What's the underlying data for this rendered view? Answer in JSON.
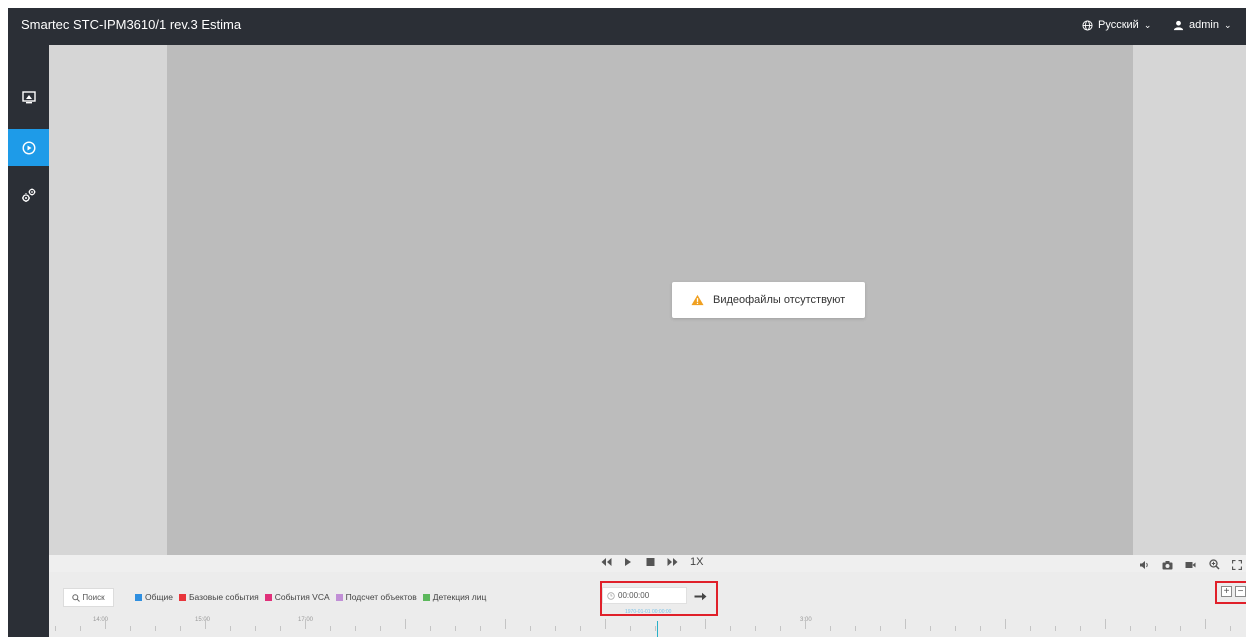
{
  "header": {
    "title": "Smartec STC-IPM3610/1 rev.3 Estima",
    "language": "Русский",
    "user": "admin"
  },
  "sidebar": {
    "items": [
      {
        "name": "live-view",
        "icon": "monitor-icon",
        "active": false
      },
      {
        "name": "playback",
        "icon": "play-circle-icon",
        "active": true
      },
      {
        "name": "settings",
        "icon": "gears-icon",
        "active": false
      }
    ]
  },
  "player": {
    "message": "Видеофайлы отсутствуют",
    "speed": "1X"
  },
  "search": {
    "label": "Поиск"
  },
  "legend": [
    {
      "label": "Общие",
      "color": "#2f8fe0"
    },
    {
      "label": "Базовые события",
      "color": "#e8353b"
    },
    {
      "label": "События VCA",
      "color": "#e0307a"
    },
    {
      "label": "Подсчет объектов",
      "color": "#c18fd6"
    },
    {
      "label": "Детекция лиц",
      "color": "#5cb85c"
    }
  ],
  "time_input": {
    "value": "00:00:00"
  },
  "timeline": {
    "labels": [
      "14:00",
      "15:00",
      "17:00",
      "3:00"
    ],
    "cursor_label": "1970-01-01 00:00:00"
  },
  "colors": {
    "accent": "#1e9be8",
    "highlight_box": "#e0202a",
    "warning": "#f0a020"
  }
}
